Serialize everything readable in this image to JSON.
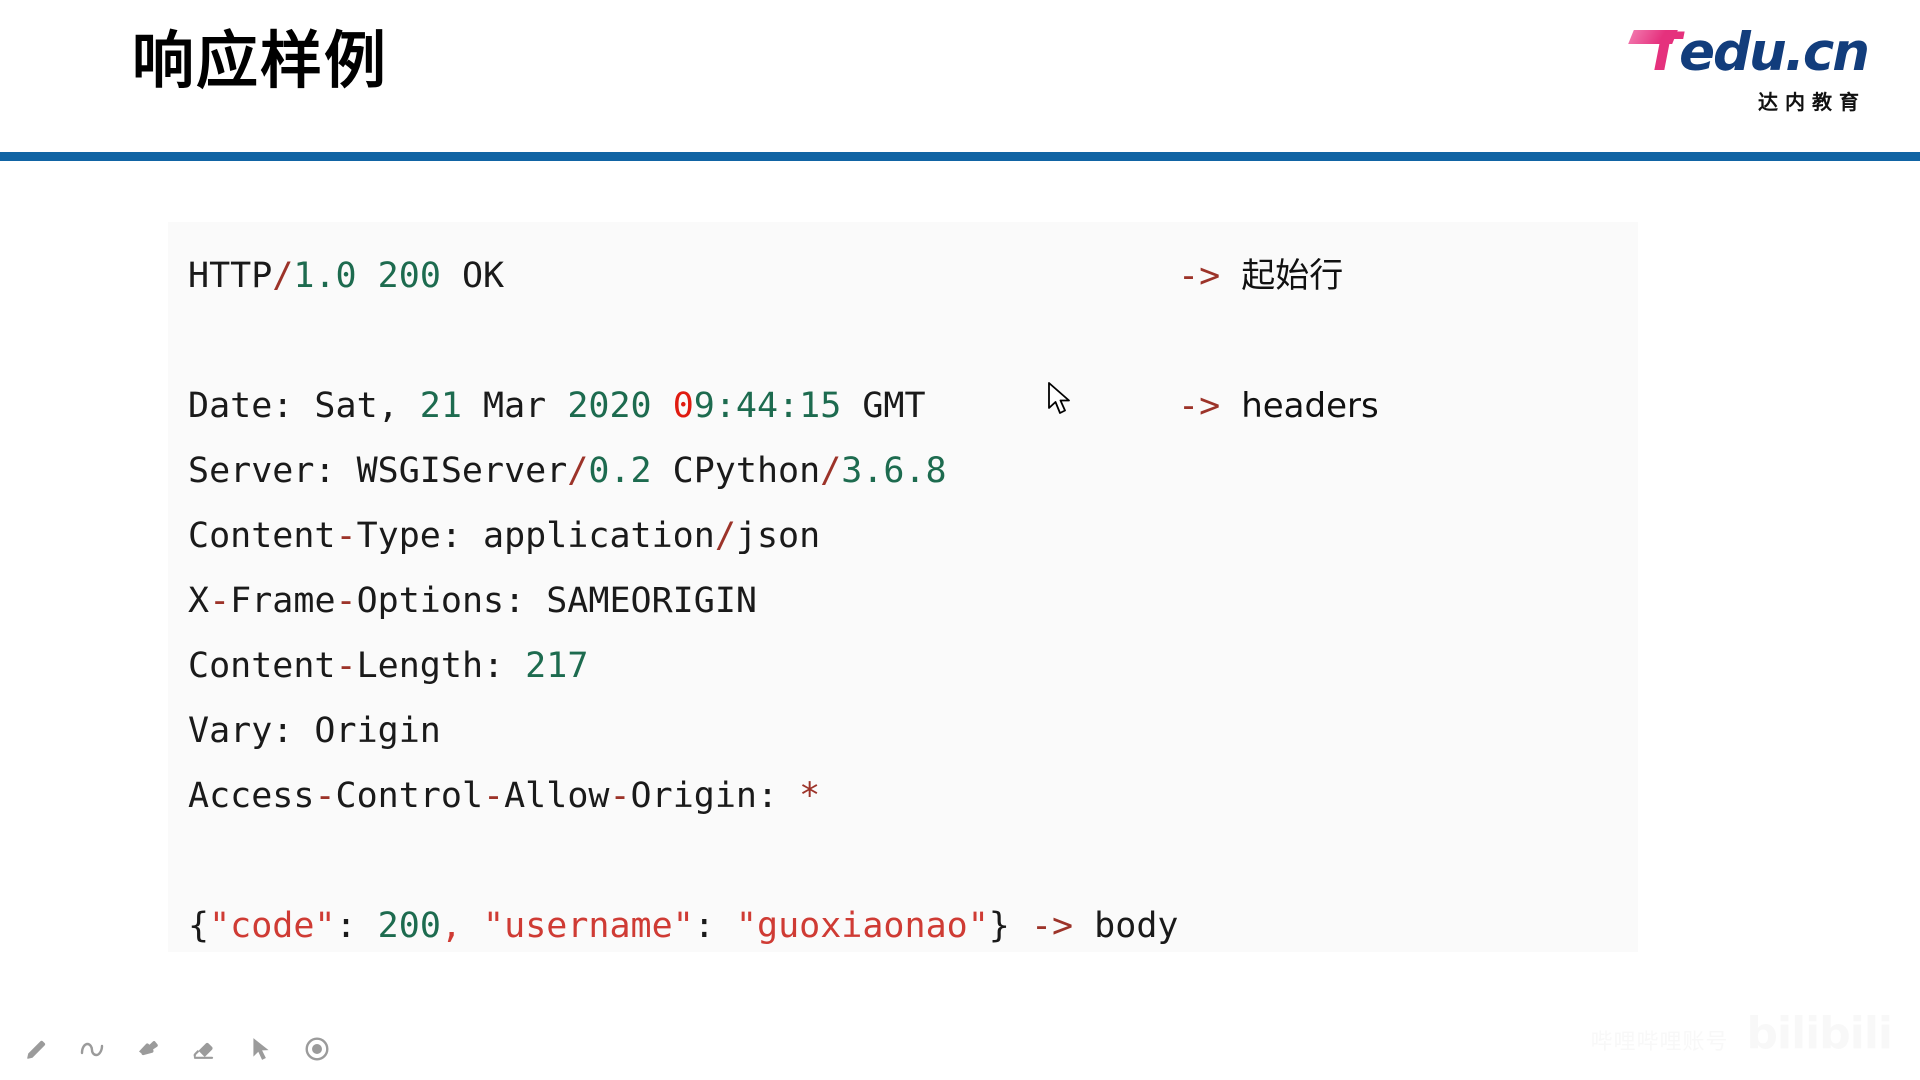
{
  "header": {
    "title": "响应样例",
    "rule_color": "#1164a4",
    "logo": {
      "word_first": "T",
      "word_rest": "edu.cn",
      "subtitle": "达内教育",
      "pink": "#e5317d",
      "blue": "#123d7c"
    }
  },
  "code_panel": {
    "background": "#fafafa",
    "lines": [
      {
        "id": "status-line",
        "tokens": [
          {
            "text": "HTTP",
            "style": "plain"
          },
          {
            "text": "/",
            "style": "punct"
          },
          {
            "text": "1.0",
            "style": "num"
          },
          {
            "text": " ",
            "style": "plain"
          },
          {
            "text": "200",
            "style": "num"
          },
          {
            "text": " OK",
            "style": "plain"
          }
        ],
        "annotation": {
          "arrow": "-> ",
          "text": "起始行"
        }
      },
      {
        "id": "blank-1",
        "tokens": [],
        "annotation": null
      },
      {
        "id": "header-date",
        "tokens": [
          {
            "text": "Date: Sat, ",
            "style": "plain"
          },
          {
            "text": "21",
            "style": "num"
          },
          {
            "text": " Mar ",
            "style": "plain"
          },
          {
            "text": "2020",
            "style": "num"
          },
          {
            "text": " ",
            "style": "plain"
          },
          {
            "text": "0",
            "style": "red"
          },
          {
            "text": "9:44:15",
            "style": "num"
          },
          {
            "text": " GMT",
            "style": "plain"
          }
        ],
        "annotation": {
          "arrow": "-> ",
          "text": "headers"
        }
      },
      {
        "id": "header-server",
        "tokens": [
          {
            "text": "Server: WSGIServer",
            "style": "plain"
          },
          {
            "text": "/",
            "style": "punct"
          },
          {
            "text": "0.2",
            "style": "num"
          },
          {
            "text": " CPython",
            "style": "plain"
          },
          {
            "text": "/",
            "style": "punct"
          },
          {
            "text": "3.6.8",
            "style": "num"
          }
        ],
        "annotation": null
      },
      {
        "id": "header-content-type",
        "tokens": [
          {
            "text": "Content",
            "style": "plain"
          },
          {
            "text": "-",
            "style": "punct"
          },
          {
            "text": "Type: application",
            "style": "plain"
          },
          {
            "text": "/",
            "style": "punct"
          },
          {
            "text": "json",
            "style": "plain"
          }
        ],
        "annotation": null
      },
      {
        "id": "header-x-frame-options",
        "tokens": [
          {
            "text": "X",
            "style": "plain"
          },
          {
            "text": "-",
            "style": "punct"
          },
          {
            "text": "Frame",
            "style": "plain"
          },
          {
            "text": "-",
            "style": "punct"
          },
          {
            "text": "Options: SAMEORIGIN",
            "style": "plain"
          }
        ],
        "annotation": null
      },
      {
        "id": "header-content-length",
        "tokens": [
          {
            "text": "Content",
            "style": "plain"
          },
          {
            "text": "-",
            "style": "punct"
          },
          {
            "text": "Length: ",
            "style": "plain"
          },
          {
            "text": "217",
            "style": "num"
          }
        ],
        "annotation": null
      },
      {
        "id": "header-vary",
        "tokens": [
          {
            "text": "Vary: Origin",
            "style": "plain"
          }
        ],
        "annotation": null
      },
      {
        "id": "header-access-control-allow-origin",
        "tokens": [
          {
            "text": "Access",
            "style": "plain"
          },
          {
            "text": "-",
            "style": "punct"
          },
          {
            "text": "Control",
            "style": "plain"
          },
          {
            "text": "-",
            "style": "punct"
          },
          {
            "text": "Allow",
            "style": "plain"
          },
          {
            "text": "-",
            "style": "punct"
          },
          {
            "text": "Origin: ",
            "style": "plain"
          },
          {
            "text": "*",
            "style": "punct"
          }
        ],
        "annotation": null
      },
      {
        "id": "blank-2",
        "tokens": [],
        "annotation": null
      },
      {
        "id": "body-json",
        "tokens": [
          {
            "text": "{",
            "style": "brace"
          },
          {
            "text": "\"code\"",
            "style": "str"
          },
          {
            "text": ": ",
            "style": "plain"
          },
          {
            "text": "200",
            "style": "num"
          },
          {
            "text": ",",
            "style": "str"
          },
          {
            "text": " ",
            "style": "plain"
          },
          {
            "text": "\"username\"",
            "style": "str"
          },
          {
            "text": ": ",
            "style": "plain"
          },
          {
            "text": "\"guoxiaonao\"",
            "style": "str"
          },
          {
            "text": "}",
            "style": "brace"
          },
          {
            "text": " ",
            "style": "plain"
          },
          {
            "text": "->",
            "style": "punct"
          },
          {
            "text": " body",
            "style": "plain"
          }
        ],
        "annotation": null
      }
    ]
  },
  "toolbar": {
    "items": [
      {
        "icon": "pencil-icon",
        "label": "Pen"
      },
      {
        "icon": "curve-icon",
        "label": "Curve"
      },
      {
        "icon": "highlighter-icon",
        "label": "Highlighter"
      },
      {
        "icon": "eraser-icon",
        "label": "Eraser"
      },
      {
        "icon": "pointer-icon",
        "label": "Select"
      },
      {
        "icon": "record-icon",
        "label": "Laser"
      }
    ],
    "color": "#9b9b9b"
  },
  "watermark": {
    "uid": "哔哩哔哩账号",
    "logo": "bilibili"
  }
}
